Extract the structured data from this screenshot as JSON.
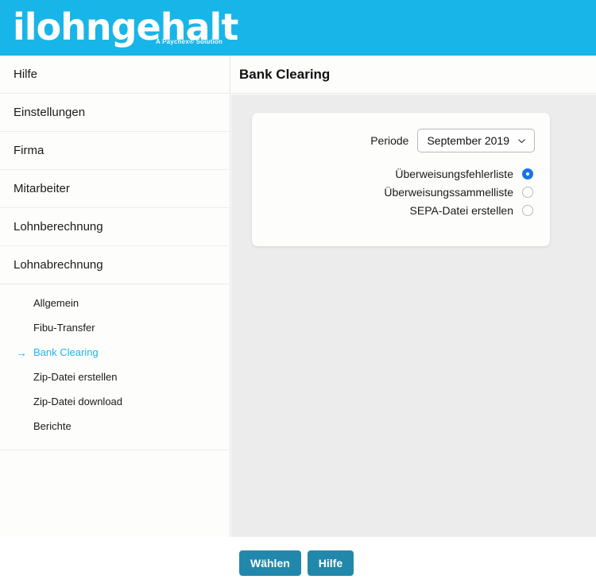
{
  "brand": {
    "logo_text": "ilohngehalt",
    "tagline": "A Paychex® Solution",
    "header_color": "#18b5e8"
  },
  "sidebar": {
    "items": [
      {
        "label": "Hilfe"
      },
      {
        "label": "Einstellungen"
      },
      {
        "label": "Firma"
      },
      {
        "label": "Mitarbeiter"
      },
      {
        "label": "Lohnberechnung"
      },
      {
        "label": "Lohnabrechnung"
      }
    ],
    "submenu": {
      "parent": "Lohnabrechnung",
      "active_color": "#1db6ec",
      "arrow_glyph": "→",
      "items": [
        {
          "label": "Allgemein",
          "active": false
        },
        {
          "label": "Fibu-Transfer",
          "active": false
        },
        {
          "label": "Bank Clearing",
          "active": true
        },
        {
          "label": "Zip-Datei erstellen",
          "active": false
        },
        {
          "label": "Zip-Datei download",
          "active": false
        },
        {
          "label": "Berichte",
          "active": false
        }
      ]
    }
  },
  "content": {
    "title": "Bank Clearing",
    "form": {
      "period": {
        "label": "Periode",
        "selected": "September 2019",
        "options": [
          "September 2019"
        ],
        "chevron_icon": "chevron-down-icon"
      },
      "report_options": {
        "selected_index": 0,
        "selected_color": "#1a73e8",
        "items": [
          {
            "label": "Überweisungsfehlerliste",
            "checked": true
          },
          {
            "label": "Überweisungssammelliste",
            "checked": false
          },
          {
            "label": "SEPA-Datei erstellen",
            "checked": false
          }
        ]
      }
    }
  },
  "actions": {
    "button_color": "#2288ab",
    "primary": "Wählen",
    "secondary": "Hilfe"
  }
}
